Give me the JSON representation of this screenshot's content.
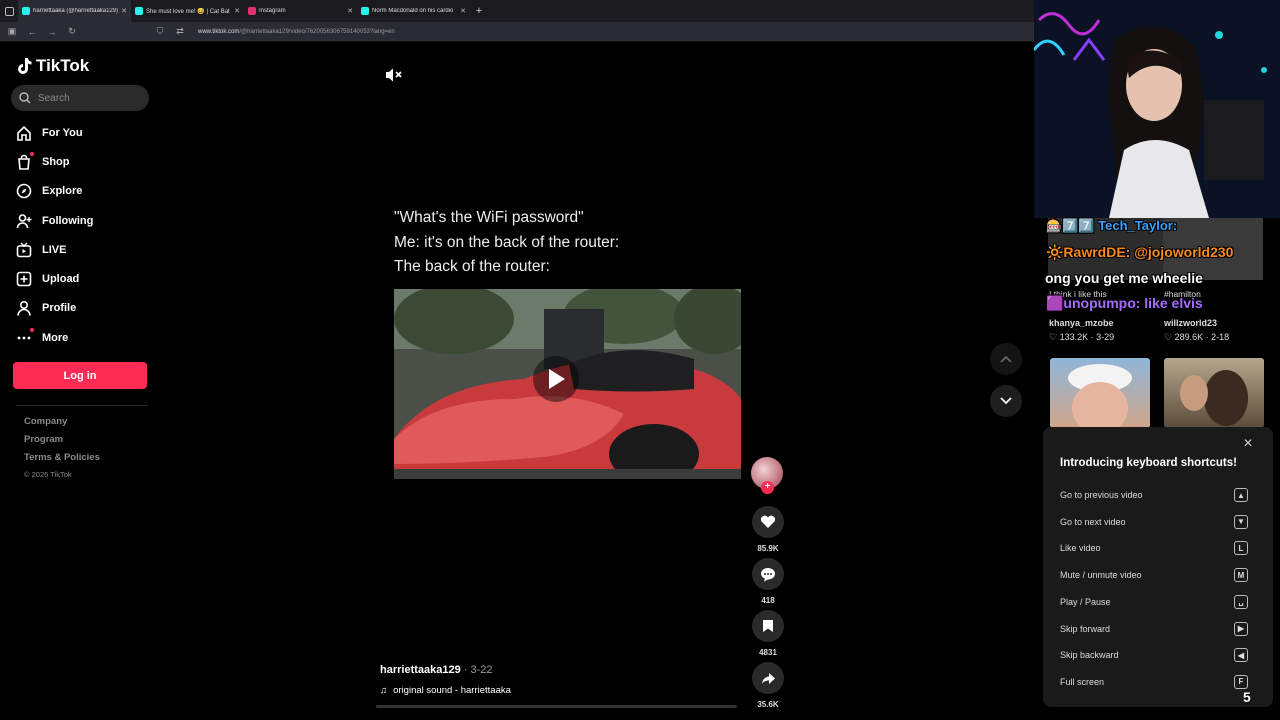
{
  "browser": {
    "tabs": [
      {
        "title": "harriettaaka (@harriettaaka129)",
        "favicon_color": "#25f4ee",
        "active": true
      },
      {
        "title": "She must love me! 😅 | Cat Bat",
        "favicon_color": "#25f4ee",
        "active": false
      },
      {
        "title": "Instagram",
        "favicon_color": "#e1306c",
        "active": false
      },
      {
        "title": "Norm Macdonald on his cardio",
        "favicon_color": "#25f4ee",
        "active": false
      }
    ],
    "url_domain": "www.tiktok.com",
    "url_path": "/@harriettaaka129/video/7620056306759140053?lang=en"
  },
  "tiktok": {
    "logo": "TikTok",
    "search_placeholder": "Search",
    "nav": [
      {
        "label": "For You",
        "icon": "home-icon"
      },
      {
        "label": "Shop",
        "icon": "shop-icon",
        "dot": true
      },
      {
        "label": "Explore",
        "icon": "explore-icon"
      },
      {
        "label": "Following",
        "icon": "following-icon"
      },
      {
        "label": "LIVE",
        "icon": "live-icon"
      },
      {
        "label": "Upload",
        "icon": "upload-icon"
      },
      {
        "label": "Profile",
        "icon": "profile-icon"
      },
      {
        "label": "More",
        "icon": "more-icon",
        "dot": true
      }
    ],
    "login_label": "Log in",
    "footer_links": [
      "Company",
      "Program",
      "Terms & Policies"
    ],
    "copyright": "© 2026 TikTok",
    "caption_lines": [
      "\"What's the WiFi password\"",
      "Me: it's on the back of the router:",
      "The back of the router:"
    ],
    "author": "harriettaaka129",
    "date": " · 3-22",
    "sound": "original sound - harriettaaka",
    "likes": "85.9K",
    "comments": "418",
    "saves": "4831",
    "shares": "35.6K"
  },
  "overlay": {
    "chat": [
      {
        "text": "🎰7️⃣7️⃣ Tech_Taylor:",
        "color": "#3aa0ff"
      },
      {
        "text": "🔆RawrdDE: @jojoworld230",
        "color": "#ff8a1c"
      },
      {
        "text": "ong you get me wheelie",
        "color": "#ffffff"
      },
      {
        "text": "🟪unopumpo: like elvis",
        "color": "#a56bff"
      }
    ],
    "grid": [
      {
        "caption": "I think i like this",
        "user": "khanya_mzobe",
        "likes": "133.2K",
        "date": "3-29"
      },
      {
        "caption": "#hamilton",
        "user": "willzworld23",
        "likes": "289.6K",
        "date": "2-18"
      }
    ],
    "shortcuts_title": "Introducing keyboard shortcuts!",
    "shortcuts": [
      {
        "label": "Go to previous video",
        "key": "▲"
      },
      {
        "label": "Go to next video",
        "key": "▼"
      },
      {
        "label": "Like video",
        "key": "L"
      },
      {
        "label": "Mute / unmute video",
        "key": "M"
      },
      {
        "label": "Play / Pause",
        "key": "␣"
      },
      {
        "label": "Skip forward",
        "key": "▶"
      },
      {
        "label": "Skip backward",
        "key": "◀"
      },
      {
        "label": "Full screen",
        "key": "F"
      }
    ],
    "corner_count": "5"
  }
}
